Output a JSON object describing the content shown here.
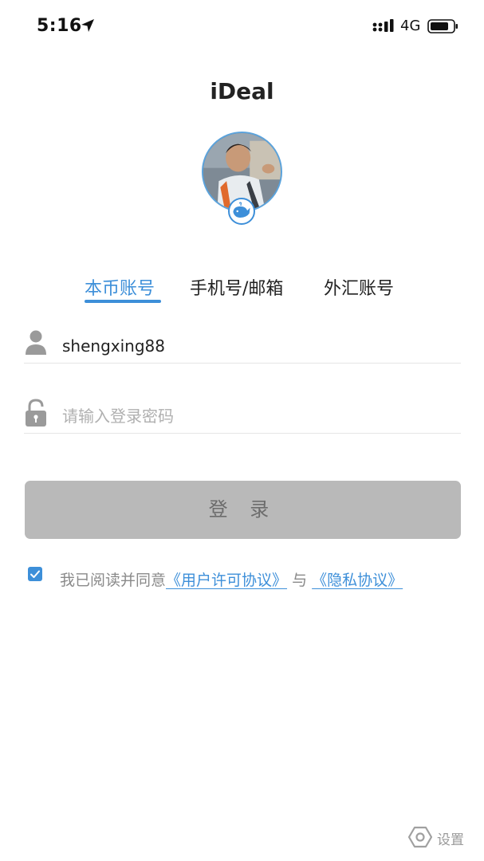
{
  "status_bar": {
    "time": "5:16",
    "network": "4G",
    "icons": [
      "location-arrow-icon",
      "signal-icon",
      "battery-icon"
    ]
  },
  "app": {
    "title": "iDeal"
  },
  "tabs": [
    {
      "label": "本币账号",
      "active": true
    },
    {
      "label": "手机号/邮箱",
      "active": false
    },
    {
      "label": "外汇账号",
      "active": false
    }
  ],
  "form": {
    "username": {
      "value": "shengxing88",
      "icon": "user-icon"
    },
    "password": {
      "value": "",
      "placeholder": "请输入登录密码",
      "icon": "lock-icon"
    },
    "login_label": "登 录"
  },
  "agreement": {
    "checked": true,
    "prefix": "我已阅读并同意",
    "link_terms": "《用户许可协议》",
    "conjunction": "与",
    "link_privacy": "《隐私协议》"
  },
  "settings": {
    "label": "设置",
    "icon": "settings-hex-icon"
  },
  "colors": {
    "accent": "#3d8fd9",
    "button_disabled": "#b9b9b9",
    "button_text": "#6c6c6c",
    "divider": "#e6e6e6",
    "placeholder": "#b0b0b0"
  }
}
